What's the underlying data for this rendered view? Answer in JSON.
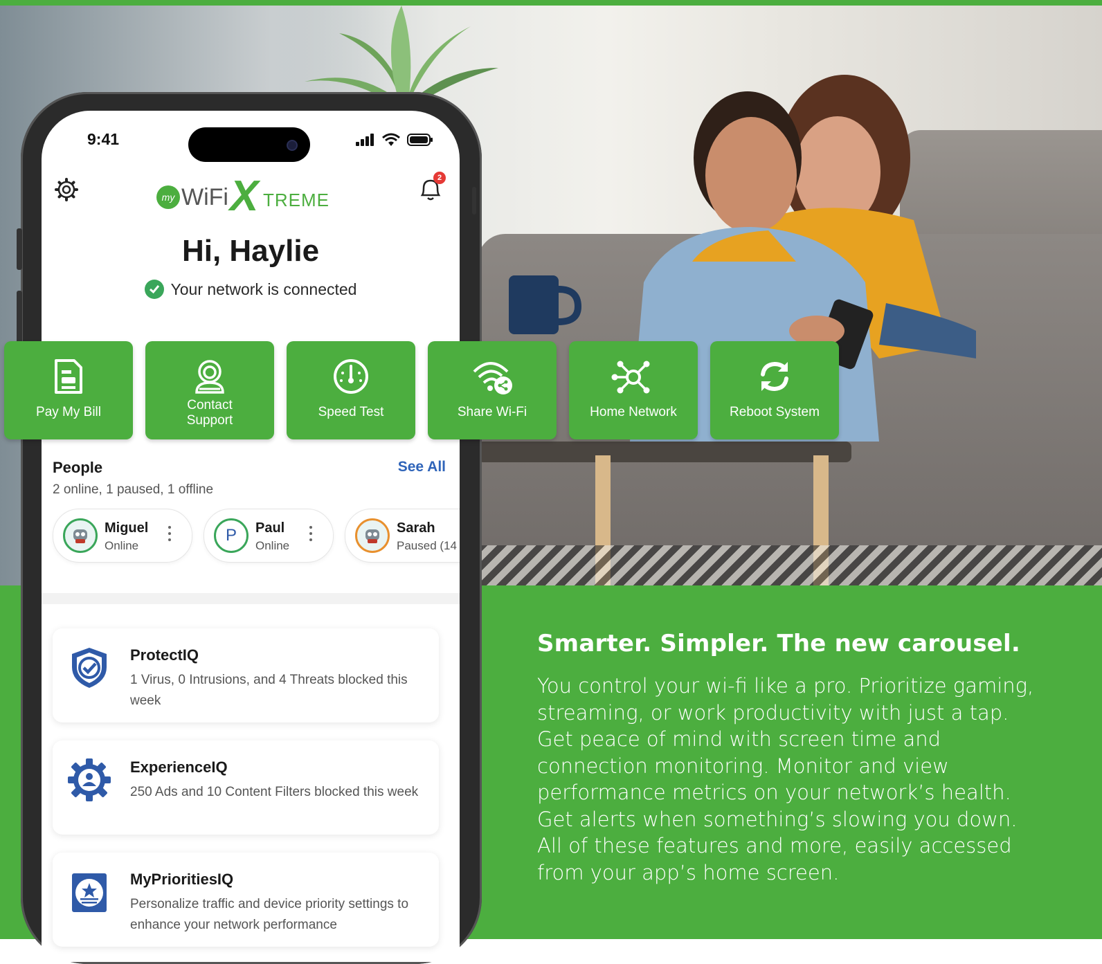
{
  "status_bar": {
    "time": "9:41"
  },
  "app": {
    "logo_prefix": "my",
    "logo_wifi": "WiFi",
    "logo_x": "X",
    "logo_treme": "TREME",
    "notification_count": "2"
  },
  "greeting": "Hi, Haylie",
  "connection_status": "Your network is connected",
  "actions": [
    {
      "label": "Pay My Bill",
      "icon": "bill-icon"
    },
    {
      "label": "Contact Support",
      "label_line1": "Contact",
      "label_line2": "Support",
      "icon": "support-icon"
    },
    {
      "label": "Speed Test",
      "icon": "speedometer-icon"
    },
    {
      "label": "Share Wi-Fi",
      "icon": "share-wifi-icon"
    },
    {
      "label": "Home Network",
      "icon": "network-hub-icon"
    },
    {
      "label": "Reboot System",
      "icon": "reboot-icon"
    }
  ],
  "people": {
    "title": "People",
    "see_all": "See All",
    "summary": "2 online, 1 paused, 1 offline",
    "list": [
      {
        "name": "Miguel",
        "status": "Online",
        "avatar": "robot-avatar"
      },
      {
        "name": "Paul",
        "status": "Online",
        "initial": "P"
      },
      {
        "name": "Sarah",
        "status": "Paused (14",
        "avatar": "robot-avatar"
      }
    ]
  },
  "cards": [
    {
      "title": "ProtectIQ",
      "desc": "1 Virus, 0 Intrusions, and 4 Threats blocked this week",
      "icon": "shield-check-icon"
    },
    {
      "title": "ExperienceIQ",
      "desc": "250 Ads and 10 Content Filters blocked this week",
      "icon": "gear-user-icon"
    },
    {
      "title": "MyPrioritiesIQ",
      "desc": "Personalize traffic and device priority settings to enhance your network performance",
      "icon": "priority-star-icon"
    }
  ],
  "promo": {
    "title": "Smarter. Simpler. The new carousel.",
    "body": "You control your wi-fi like a pro. Prioritize gaming, streaming, or work productivity with just a tap. Get peace of mind with screen time and connection monitoring. Monitor and view performance metrics on your network’s health. Get alerts when something’s slowing you down. All of these features and more, easily accessed from your app’s home screen."
  },
  "colors": {
    "brand_green": "#4cae3f",
    "link_blue": "#2f64b9",
    "icon_blue": "#2f5aa8"
  }
}
